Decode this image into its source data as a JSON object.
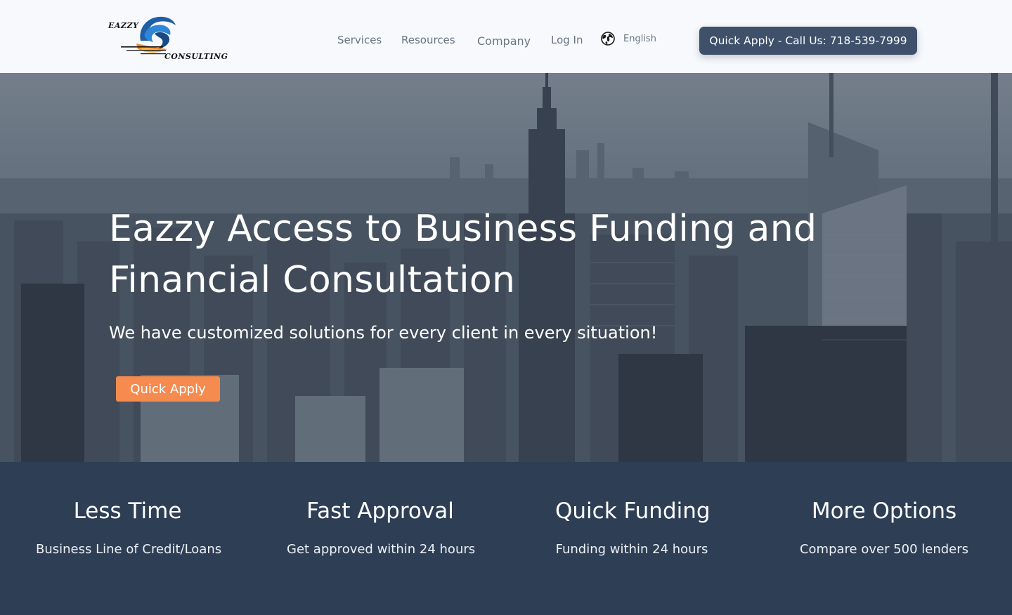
{
  "header": {
    "logo": {
      "top_text": "EAZZY",
      "bottom_text": "CONSULTING"
    },
    "nav": [
      {
        "label": "Services"
      },
      {
        "label": "Resources"
      },
      {
        "label": "Company"
      },
      {
        "label": "Log In"
      }
    ],
    "language": {
      "icon": "globe-icon",
      "label": "English"
    },
    "cta_label": "Quick Apply - Call Us: 718-539-7999"
  },
  "hero": {
    "title": "Eazzy Access to Business Funding and Financial Consultation",
    "subtitle": "We have customized solutions for every client in every situation!",
    "button_label": "Quick Apply"
  },
  "features": [
    {
      "title": "Less Time",
      "description": "Business Line of Credit/Loans"
    },
    {
      "title": "Fast Approval",
      "description": "Get approved within 24 hours"
    },
    {
      "title": "Quick Funding",
      "description": "Funding within 24 hours"
    },
    {
      "title": "More Options",
      "description": "Compare over 500 lenders"
    }
  ],
  "colors": {
    "header_bg": "#f7f9fc",
    "nav_text": "#6a7585",
    "cta_bg": "#3e506a",
    "accent_orange": "#f58b4f",
    "features_bg": "#2d3e55"
  }
}
